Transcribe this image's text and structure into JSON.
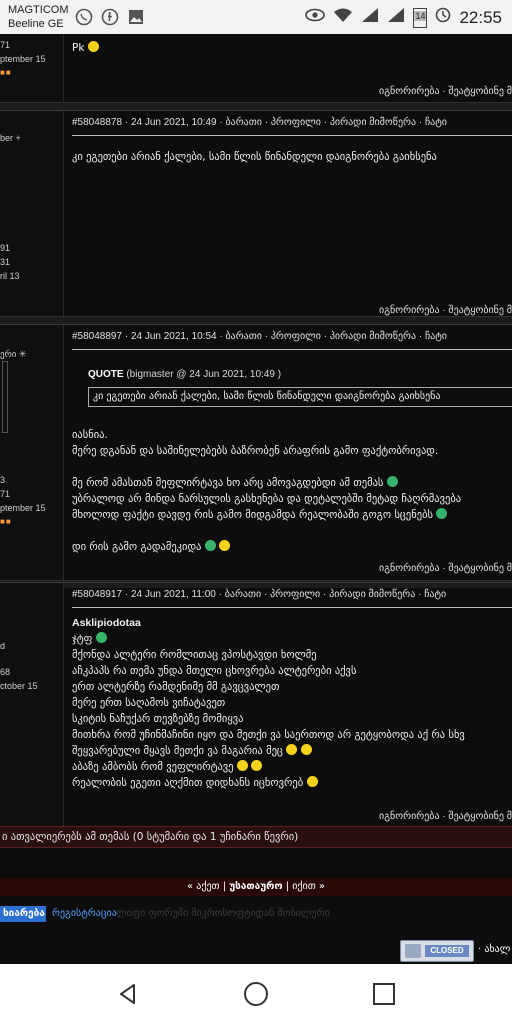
{
  "status_bar": {
    "carrier_line1": "MAGTICOM",
    "carrier_line2": "Beeline GE",
    "battery": "14",
    "time": "22:55"
  },
  "post0": {
    "sidebar": [
      "71",
      "ptember 15"
    ],
    "body": "Pk",
    "footer": "იგნორირება · შეატყობინე მ"
  },
  "post1": {
    "header": "#58048878 · 24 Jun 2021, 10:49 · ბარათი · პროფილი · პირადი მიმოწერა · ჩატი",
    "sidebar": [
      "ber +",
      "91",
      "31",
      "ril 13"
    ],
    "body": "კი ეგეთები არიან ქალები, სამი წლის წინანდელი დაიგნორება გაიხსენა",
    "footer": "იგნორირება · შეატყობინე მ"
  },
  "post2": {
    "header": "#58048897 · 24 Jun 2021, 10:54 · ბარათი · პროფილი · პირადი მიმოწერა · ჩატი",
    "sidebar": [
      "ერი ✳",
      "3",
      "71",
      "ptember 15"
    ],
    "quote_label": "QUOTE",
    "quote_meta": "(bigmaster @ 24 Jun 2021, 10:49 )",
    "quote_text": "კი ეგეთები არიან ქალები, სამი წლის წინანდელი დაიგნორება გაიხსენა",
    "lines": [
      "იასნია.",
      "მერე დგანან და საშინელებებს ბაზრობენ არაფრის გამო ფაქტობრივად.",
      "მე რომ ამასთან მეფლირტავა ხო არც ამოვაგდებდი ამ თემას",
      "უბრალოდ არ მინდა ნარსულის გასხენება და დეტალებში მეტად ჩაღრმავება",
      "მხოლოდ ფაქტი დავდე რის გამო მიდგამდა რეალობაში გოგო სცენებს",
      "დი რის გამო გადამეკიდა"
    ],
    "footer": "იგნორირება · შეატყობინე მ"
  },
  "post3": {
    "header": "#58048917 · 24 Jun 2021, 11:00 · ბარათი · პროფილი · პირადი მიმოწერა · ჩატი",
    "sidebar": [
      "d",
      "68",
      "ctober 15"
    ],
    "author": "Asklipiodotaa",
    "lines": [
      "ჯტფ",
      "მქონდა ალტერი რომლითაც ვპოსტავდი ხოლმე",
      "აჩკპაპს რა თემა უნდა მთელი ცხოვრება ალტერები აქვს",
      "ერთ ალტერზე რამდენიმე მმ გავცვალეთ",
      "მერე ერთ საღამოს ვიჩატავეთ",
      "სკიტის ნაჩუქარ თევზებზე მომიყვა",
      "მითხრა რომ უჩინმაჩინი იყო და მეთქი ვა საერთოდ არ გეტყობოდა აქ რა სხვ",
      "შეყვარებული მყავს მეთქი ვა მაგარია მეც",
      "აბაზე ამბობს რომ ვეფლირტავე",
      "რეალობის ეგეთი აღქმით დიდხანს იცხოვრებ"
    ],
    "footer": "იგნორირება · შეატყობინე მ"
  },
  "summary": "ი ათვალიერებს ამ თემას (0 სტუმარი და 1 უჩინარი წევრი)",
  "pagination": {
    "prev": "« აქეთ",
    "sep1": " | ",
    "current": "უსათაურო",
    "sep2": " | ",
    "next": "იქით »"
  },
  "bottom": {
    "login": "ხიარება",
    "register": "რეგისტრაცია",
    "faded": "ლიფი ფორუმი მიკროსოფტიდან მობილური"
  },
  "closed_badge": "CLOSED",
  "new_topic_partial": "· ახალ",
  "colors": {
    "accent_blue": "#2d6fd0",
    "summary_bar": "#2a0f0f",
    "pagination_bar": "#2a0808"
  },
  "icons": {
    "status": [
      "viber-icon",
      "facebook-icon",
      "gallery-icon",
      "eye-icon",
      "wifi-icon",
      "signal-icon",
      "battery-icon",
      "alarm-icon"
    ],
    "nav": [
      "back-icon",
      "home-icon",
      "recents-icon"
    ]
  }
}
